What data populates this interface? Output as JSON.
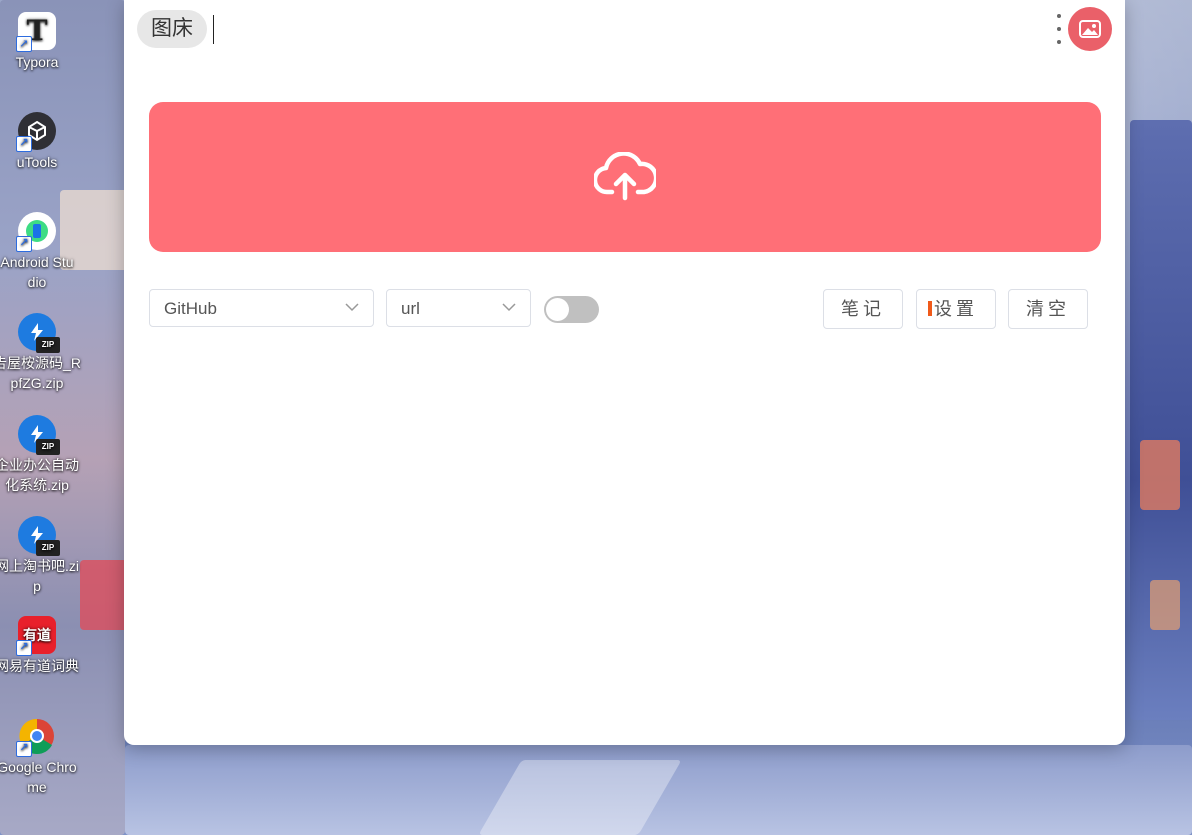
{
  "desktop": {
    "icons": [
      {
        "label": "Typora",
        "icon": "typora-icon"
      },
      {
        "label": "uTools",
        "icon": "utools-icon"
      },
      {
        "label": "Android Stu dio",
        "line1": "Android Stu",
        "line2": "dio",
        "icon": "android-studio-icon"
      },
      {
        "line1": "告屋桉源码_R",
        "line2": "pfZG.zip",
        "icon": "zip-icon"
      },
      {
        "line1": "企业办公自动",
        "line2": "化系统.zip",
        "icon": "zip-icon"
      },
      {
        "line1": "网上淘书吧.zi",
        "line2": "p",
        "icon": "zip-icon"
      },
      {
        "label": "网易有道词典",
        "icon": "youdao-icon",
        "badge": "有道"
      },
      {
        "line1": "Google Chro",
        "line2": "me",
        "icon": "chrome-icon"
      }
    ]
  },
  "app": {
    "title": "图床",
    "upload_icon": "cloud-upload-icon",
    "host_select": {
      "value": "GitHub"
    },
    "format_select": {
      "value": "url"
    },
    "toggle": {
      "on": false
    },
    "buttons": {
      "notes": "笔记",
      "settings": "设置",
      "clear": "清空"
    },
    "colors": {
      "accent": "#ff6f77",
      "avatar": "#ea6069"
    }
  }
}
